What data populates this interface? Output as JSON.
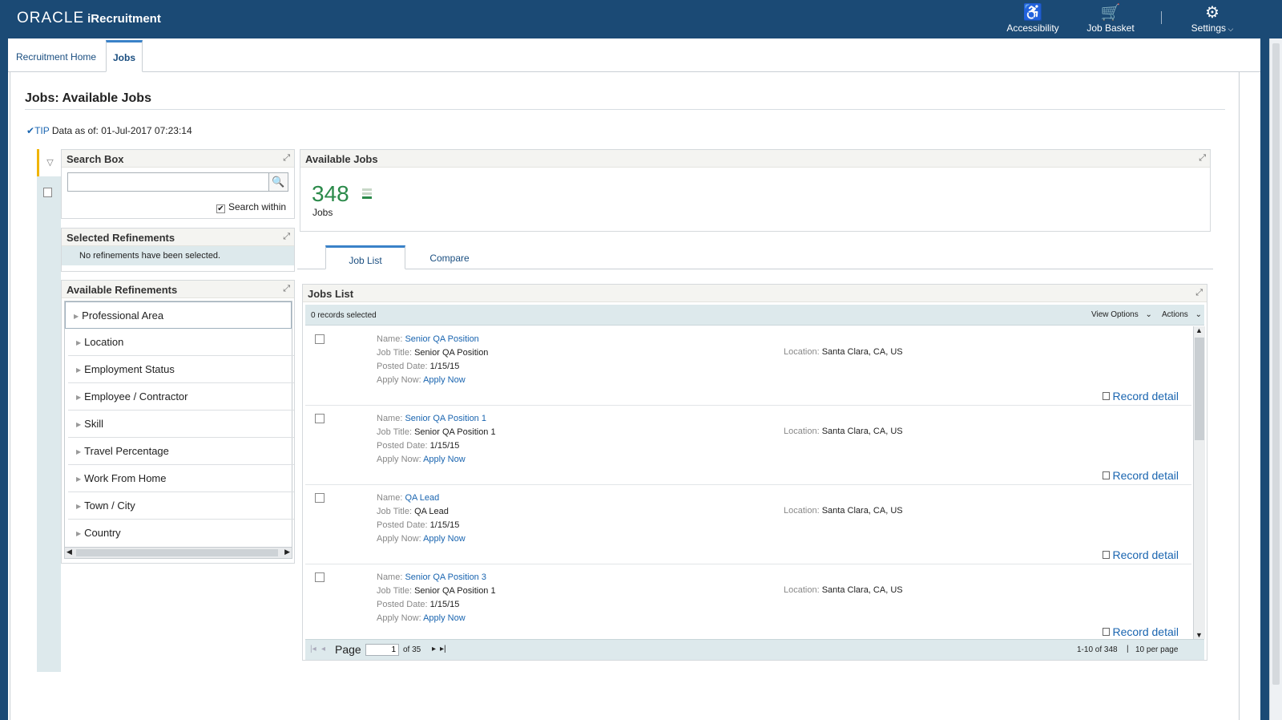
{
  "header": {
    "logo_brand": "ORACLE",
    "logo_product": "iRecruitment",
    "accessibility_label": "Accessibility",
    "job_basket_label": "Job Basket",
    "settings_label": "Settings"
  },
  "tabs": {
    "recruitment_home": "Recruitment Home",
    "jobs": "Jobs"
  },
  "page": {
    "title": "Jobs: Available Jobs",
    "tip_label": "TIP",
    "tip_text": "Data as of: 01-Jul-2017 07:23:14"
  },
  "search_box": {
    "title": "Search Box",
    "value": "",
    "search_within_label": "Search within",
    "search_within_checked": true
  },
  "selected_refinements": {
    "title": "Selected Refinements",
    "empty_text": "No refinements have been selected."
  },
  "available_refinements": {
    "title": "Available Refinements",
    "items": [
      "Professional Area",
      "Location",
      "Employment Status",
      "Employee / Contractor",
      "Skill",
      "Travel Percentage",
      "Work From Home",
      "Town / City",
      "Country"
    ]
  },
  "available_jobs": {
    "title": "Available Jobs",
    "count": "348",
    "count_label": "Jobs"
  },
  "content_tabs": {
    "job_list": "Job List",
    "compare": "Compare"
  },
  "jobs_list": {
    "title": "Jobs List",
    "records_selected": "0 records selected",
    "view_options": "View Options",
    "actions": "Actions",
    "labels": {
      "name": "Name:",
      "job_title": "Job Title:",
      "posted_date": "Posted Date:",
      "apply_now": "Apply Now:",
      "location": "Location:",
      "record_detail": "Record detail"
    },
    "records": [
      {
        "name": "Senior QA Position",
        "job_title": "Senior QA Position",
        "posted_date": "1/15/15",
        "apply_now": "Apply Now",
        "location": "Santa Clara, CA, US"
      },
      {
        "name": "Senior QA Position 1",
        "job_title": "Senior QA Position 1",
        "posted_date": "1/15/15",
        "apply_now": "Apply Now",
        "location": "Santa Clara, CA, US"
      },
      {
        "name": "QA Lead",
        "job_title": "QA Lead",
        "posted_date": "1/15/15",
        "apply_now": "Apply Now",
        "location": "Santa Clara, CA, US"
      },
      {
        "name": "Senior QA Position 3",
        "job_title": "Senior QA Position 1",
        "posted_date": "1/15/15",
        "apply_now": "Apply Now",
        "location": "Santa Clara, CA, US"
      }
    ],
    "pager": {
      "page_label": "Page",
      "page_value": "1",
      "of_text": "of 35",
      "range_text": "1-10 of 348",
      "per_page_text": "10 per page"
    }
  },
  "colors": {
    "header_bg": "#1b4a75",
    "accent_blue": "#3a82c8",
    "count_green": "#2b8a4a",
    "link": "#1a65b0"
  }
}
